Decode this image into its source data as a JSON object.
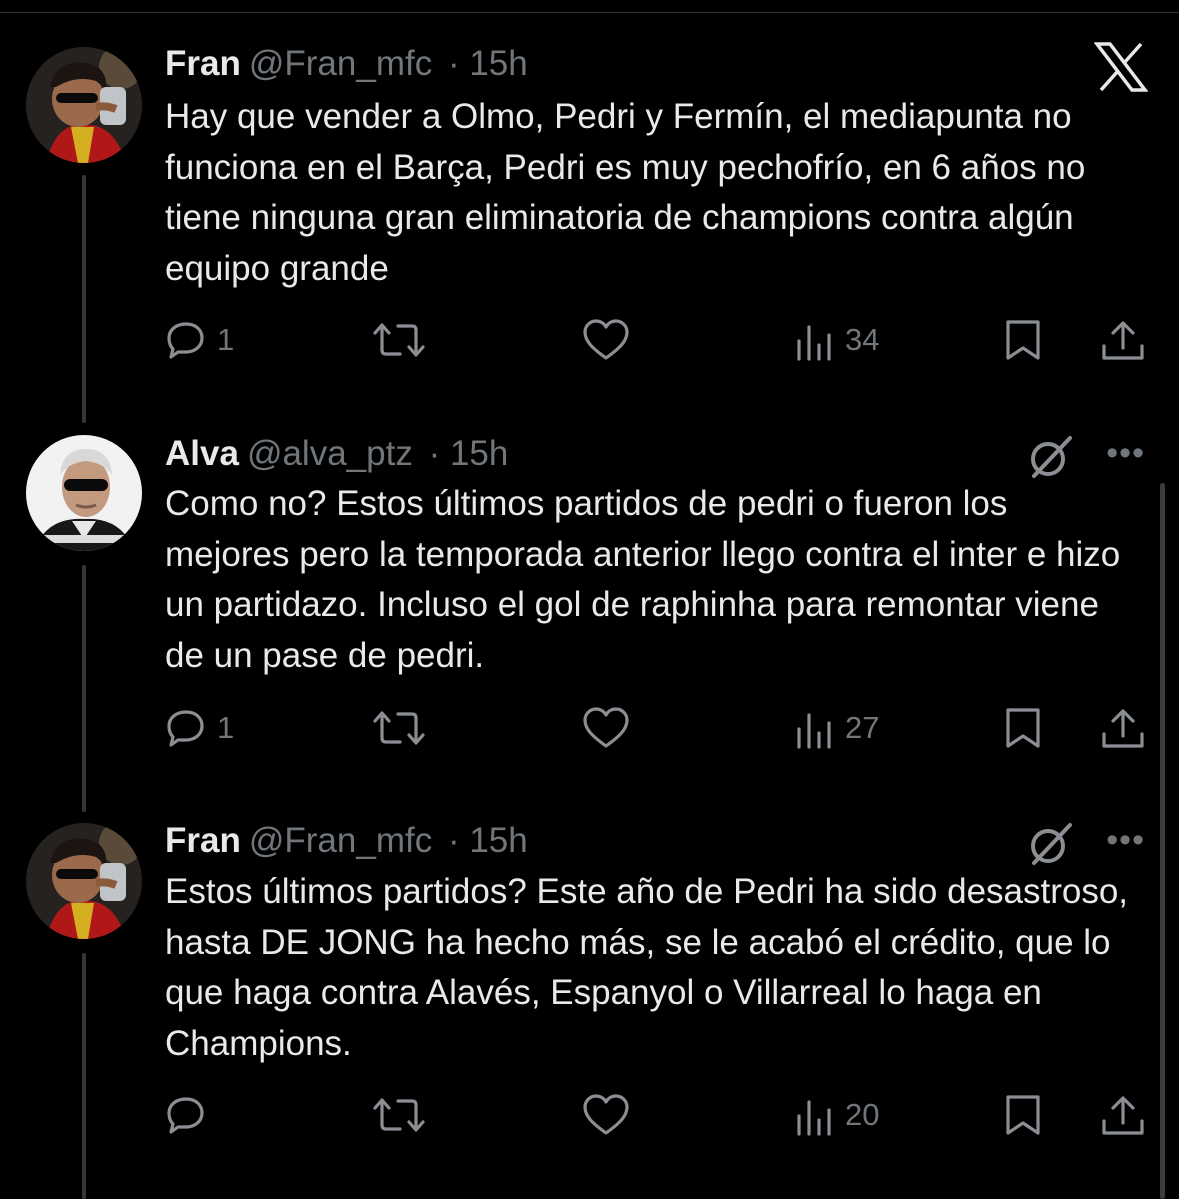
{
  "brand": {
    "logo_icon": "x-logo-icon"
  },
  "tweets": [
    {
      "name": "Fran",
      "handle": "@Fran_mfc",
      "time": "· 15h",
      "text": "Hay que vender a Olmo, Pedri y Fermín, el mediapunta no funciona en el Barça, Pedri es muy pechofrío, en 6 años no tiene ninguna gran eliminatoria de champions contra algún equipo grande",
      "replies": "1",
      "views": "34"
    },
    {
      "name": "Alva",
      "handle": "@alva_ptz",
      "time": "· 15h",
      "text": "Como no? Estos últimos partidos de pedri o fueron los mejores pero la temporada anterior llego contra el inter e hizo un partidazo. Incluso el gol de raphinha para remontar viene de un pase de pedri.",
      "replies": "1",
      "views": "27",
      "more": "•••"
    },
    {
      "name": "Fran",
      "handle": "@Fran_mfc",
      "time": "· 15h",
      "text": "Estos últimos partidos? Este año de Pedri ha sido desastroso, hasta DE JONG ha hecho más, se le acabó el crédito, que lo que haga contra Alavés, Espanyol o Villarreal lo haga en Champions.",
      "replies": "",
      "views": "20",
      "more": "•••"
    }
  ]
}
